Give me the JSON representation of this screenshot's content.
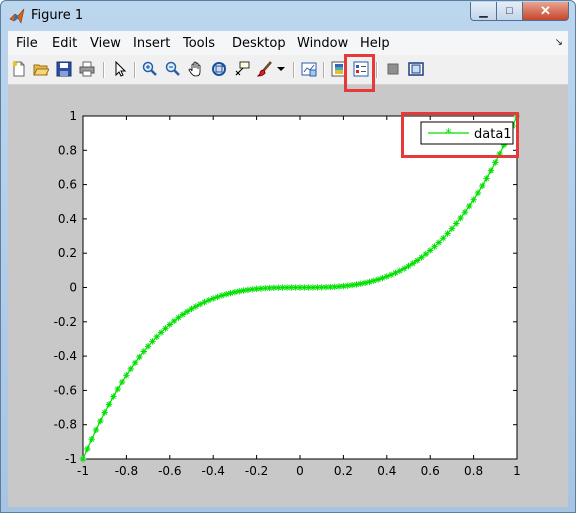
{
  "window": {
    "title": "Figure 1"
  },
  "menu": [
    "File",
    "Edit",
    "View",
    "Insert",
    "Tools",
    "Desktop",
    "Window",
    "Help"
  ],
  "toolbar": {
    "icons": [
      "new-figure-icon",
      "open-file-icon",
      "save-icon",
      "print-icon",
      "edit-plot-arrow-icon",
      "zoom-in-icon",
      "zoom-out-icon",
      "pan-hand-icon",
      "rotate-3d-icon",
      "data-cursor-icon",
      "brush-icon",
      "brush-dropdown-icon",
      "link-plot-icon",
      "insert-colorbar-icon",
      "insert-legend-icon",
      "hide-plot-tools-icon",
      "show-plot-tools-icon"
    ]
  },
  "chart_data": {
    "type": "line",
    "function": "y = x^3",
    "x_range": [
      -1,
      1
    ],
    "x": [
      -1,
      -0.98,
      -0.96,
      -0.94,
      -0.92,
      -0.9,
      -0.88,
      -0.86,
      -0.84,
      -0.82,
      -0.8,
      -0.78,
      -0.76,
      -0.74,
      -0.72,
      -0.7,
      -0.68,
      -0.66,
      -0.64,
      -0.62,
      -0.6,
      -0.58,
      -0.56,
      -0.54,
      -0.52,
      -0.5,
      -0.48,
      -0.46,
      -0.44,
      -0.42,
      -0.4,
      -0.38,
      -0.36,
      -0.34,
      -0.32,
      -0.3,
      -0.28,
      -0.26,
      -0.24,
      -0.22,
      -0.2,
      -0.18,
      -0.16,
      -0.14,
      -0.12,
      -0.1,
      -0.08,
      -0.06,
      -0.04,
      -0.02,
      0,
      0.02,
      0.04,
      0.06,
      0.08,
      0.1,
      0.12,
      0.14,
      0.16,
      0.18,
      0.2,
      0.22,
      0.24,
      0.26,
      0.28,
      0.3,
      0.32,
      0.34,
      0.36,
      0.38,
      0.4,
      0.42,
      0.44,
      0.46,
      0.48,
      0.5,
      0.52,
      0.54,
      0.56,
      0.58,
      0.6,
      0.62,
      0.64,
      0.66,
      0.68,
      0.7,
      0.72,
      0.74,
      0.76,
      0.78,
      0.8,
      0.82,
      0.84,
      0.86,
      0.88,
      0.9,
      0.92,
      0.94,
      0.96,
      0.98,
      1
    ],
    "series": [
      {
        "name": "data1",
        "color": "#00e000",
        "marker": "*"
      }
    ],
    "xlim": [
      -1,
      1
    ],
    "ylim": [
      -1,
      1
    ],
    "xticks": [
      "-1",
      "-0.8",
      "-0.6",
      "-0.4",
      "-0.2",
      "0",
      "0.2",
      "0.4",
      "0.6",
      "0.8",
      "1"
    ],
    "yticks": [
      "-1",
      "-0.8",
      "-0.6",
      "-0.4",
      "-0.2",
      "0",
      "0.2",
      "0.4",
      "0.6",
      "0.8",
      "1"
    ],
    "title": "",
    "xlabel": "",
    "ylabel": "",
    "grid": false,
    "legend_position": "top-right"
  },
  "colors": {
    "highlight": "#e8393a",
    "figure_bg": "#c8c8c8",
    "series": "#00e000"
  }
}
